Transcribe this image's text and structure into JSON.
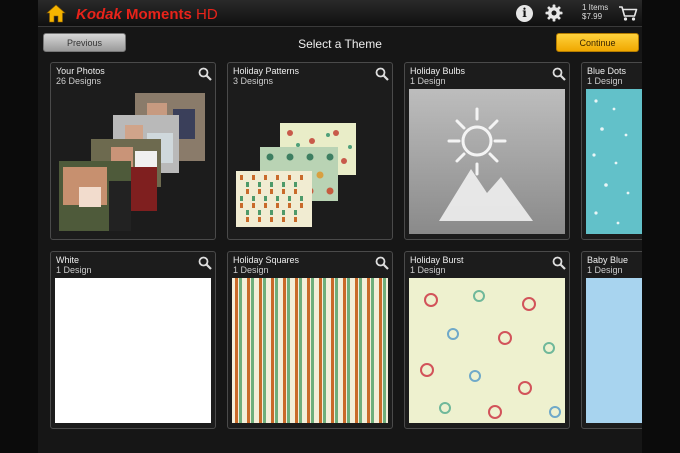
{
  "app": {
    "brand_kodak": "Kodak",
    "brand_moments": "Moments",
    "brand_hd": "HD",
    "cart_count": "1 Items",
    "cart_price": "$7.99"
  },
  "nav": {
    "previous_label": "Previous",
    "title": "Select a Theme",
    "continue_label": "Continue"
  },
  "colors": {
    "accent": "#f5b400",
    "brand_red": "#e8231a",
    "background": "#161616"
  },
  "icons": {
    "home": "home-icon",
    "info": "info-icon",
    "settings": "gear-icon",
    "cart": "cart-icon",
    "zoom": "magnifier-icon"
  },
  "themes": [
    {
      "name": "Your Photos",
      "count": "26 Designs"
    },
    {
      "name": "Holiday Patterns",
      "count": "3 Designs"
    },
    {
      "name": "Holiday Bulbs",
      "count": "1 Design"
    },
    {
      "name": "Blue Dots",
      "count": "1 Design"
    },
    {
      "name": "White",
      "count": "1 Design"
    },
    {
      "name": "Holiday Squares",
      "count": "1 Design"
    },
    {
      "name": "Holiday Burst",
      "count": "1 Design"
    },
    {
      "name": "Baby Blue",
      "count": "1 Design"
    }
  ]
}
